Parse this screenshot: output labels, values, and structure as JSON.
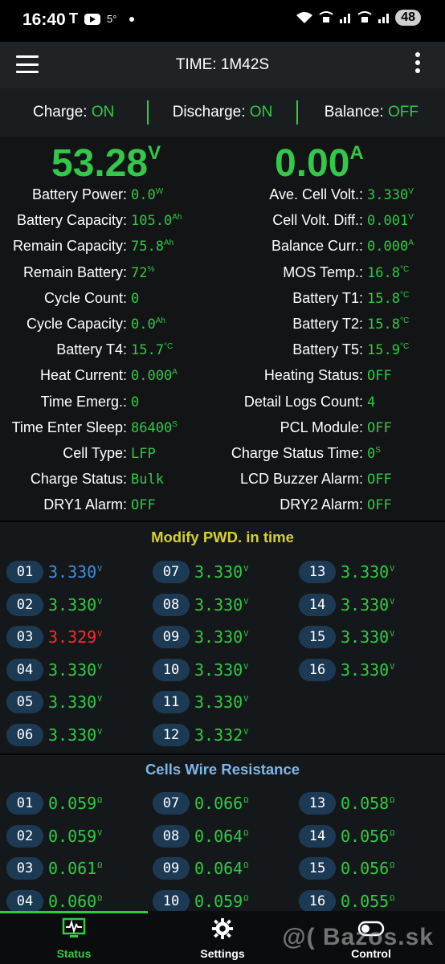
{
  "status_bar": {
    "time": "16:40",
    "left_icons": [
      "tesla-icon",
      "youtube-icon",
      "temperature-icon",
      "dot-icon"
    ],
    "temp": "5°",
    "battery": "48"
  },
  "app_bar": {
    "title": "TIME: 1M42S"
  },
  "charge_status": {
    "charge_label": "Charge: ",
    "charge_value": "ON",
    "discharge_label": "Discharge: ",
    "discharge_value": "ON",
    "balance_label": "Balance: ",
    "balance_value": "OFF"
  },
  "main": {
    "voltage": "53.28",
    "voltage_unit": "V",
    "current": "0.00",
    "current_unit": "A",
    "left": [
      {
        "label": "Battery Power:",
        "value": "0.0",
        "unit": "W"
      },
      {
        "label": "Battery Capacity:",
        "value": "105.0",
        "unit": "Ah"
      },
      {
        "label": "Remain Capacity:",
        "value": "75.8",
        "unit": "Ah"
      },
      {
        "label": "Remain Battery:",
        "value": "72",
        "unit": "%"
      },
      {
        "label": "Cycle Count:",
        "value": "0",
        "unit": ""
      },
      {
        "label": "Cycle Capacity:",
        "value": "0.0",
        "unit": "Ah"
      },
      {
        "label": "Battery T4:",
        "value": "15.7",
        "unit": "°C"
      },
      {
        "label": "Heat Current:",
        "value": "0.000",
        "unit": "A"
      },
      {
        "label": "Time Emerg.:",
        "value": "0",
        "unit": ""
      },
      {
        "label": "Time Enter Sleep:",
        "value": "86400",
        "unit": "S"
      },
      {
        "label": "Cell Type:",
        "value": "LFP",
        "unit": ""
      },
      {
        "label": "Charge Status:",
        "value": "Bulk",
        "unit": ""
      },
      {
        "label": "DRY1 Alarm:",
        "value": "OFF",
        "unit": ""
      }
    ],
    "right": [
      {
        "label": "Ave. Cell Volt.:",
        "value": "3.330",
        "unit": "V"
      },
      {
        "label": "Cell Volt. Diff.:",
        "value": "0.001",
        "unit": "V"
      },
      {
        "label": "Balance Curr.:",
        "value": "0.000",
        "unit": "A"
      },
      {
        "label": "MOS Temp.:",
        "value": "16.8",
        "unit": "°C"
      },
      {
        "label": "Battery T1:",
        "value": "15.8",
        "unit": "°C"
      },
      {
        "label": "Battery T2:",
        "value": "15.8",
        "unit": "°C"
      },
      {
        "label": "Battery T5:",
        "value": "15.9",
        "unit": "°C"
      },
      {
        "label": "Heating Status:",
        "value": "OFF",
        "unit": ""
      },
      {
        "label": "Detail Logs Count:",
        "value": "4",
        "unit": ""
      },
      {
        "label": "PCL Module:",
        "value": "OFF",
        "unit": ""
      },
      {
        "label": "Charge Status Time:",
        "value": "0",
        "unit": "S"
      },
      {
        "label": "LCD Buzzer Alarm:",
        "value": "OFF",
        "unit": ""
      },
      {
        "label": "DRY2 Alarm:",
        "value": "OFF",
        "unit": ""
      }
    ]
  },
  "cells": {
    "title": "Modify PWD. in time",
    "title_color": "#d6cf2e",
    "items": [
      {
        "id": "01",
        "value": "3.330",
        "unit": "V",
        "color": "#3d8fe0"
      },
      {
        "id": "02",
        "value": "3.330",
        "unit": "V",
        "color": "#2ecc40"
      },
      {
        "id": "03",
        "value": "3.329",
        "unit": "V",
        "color": "#ff2a2a"
      },
      {
        "id": "04",
        "value": "3.330",
        "unit": "V",
        "color": "#2ecc40"
      },
      {
        "id": "05",
        "value": "3.330",
        "unit": "V",
        "color": "#2ecc40"
      },
      {
        "id": "06",
        "value": "3.330",
        "unit": "V",
        "color": "#2ecc40"
      },
      {
        "id": "07",
        "value": "3.330",
        "unit": "V",
        "color": "#2ecc40"
      },
      {
        "id": "08",
        "value": "3.330",
        "unit": "V",
        "color": "#2ecc40"
      },
      {
        "id": "09",
        "value": "3.330",
        "unit": "V",
        "color": "#2ecc40"
      },
      {
        "id": "10",
        "value": "3.330",
        "unit": "V",
        "color": "#2ecc40"
      },
      {
        "id": "11",
        "value": "3.330",
        "unit": "V",
        "color": "#2ecc40"
      },
      {
        "id": "12",
        "value": "3.332",
        "unit": "V",
        "color": "#2ecc40"
      },
      {
        "id": "13",
        "value": "3.330",
        "unit": "V",
        "color": "#2ecc40"
      },
      {
        "id": "14",
        "value": "3.330",
        "unit": "V",
        "color": "#2ecc40"
      },
      {
        "id": "15",
        "value": "3.330",
        "unit": "V",
        "color": "#2ecc40"
      },
      {
        "id": "16",
        "value": "3.330",
        "unit": "V",
        "color": "#2ecc40"
      }
    ]
  },
  "resistance": {
    "title": "Cells Wire Resistance",
    "title_color": "#7fb6e8",
    "items": [
      {
        "id": "01",
        "value": "0.059",
        "unit": "Ω"
      },
      {
        "id": "02",
        "value": "0.059",
        "unit": "V"
      },
      {
        "id": "03",
        "value": "0.061",
        "unit": "Ω"
      },
      {
        "id": "04",
        "value": "0.060",
        "unit": "Ω"
      },
      {
        "id": "07",
        "value": "0.066",
        "unit": "Ω"
      },
      {
        "id": "08",
        "value": "0.064",
        "unit": "Ω"
      },
      {
        "id": "09",
        "value": "0.064",
        "unit": "Ω"
      },
      {
        "id": "10",
        "value": "0.059",
        "unit": "Ω"
      },
      {
        "id": "13",
        "value": "0.058",
        "unit": "Ω"
      },
      {
        "id": "14",
        "value": "0.056",
        "unit": "Ω"
      },
      {
        "id": "15",
        "value": "0.056",
        "unit": "Ω"
      },
      {
        "id": "16",
        "value": "0.055",
        "unit": "Ω"
      }
    ]
  },
  "nav": {
    "status_label": "Status",
    "settings_label": "Settings",
    "control_label": "Control",
    "active_color": "#2ecc40"
  },
  "watermark": "@( Bazos.sk"
}
